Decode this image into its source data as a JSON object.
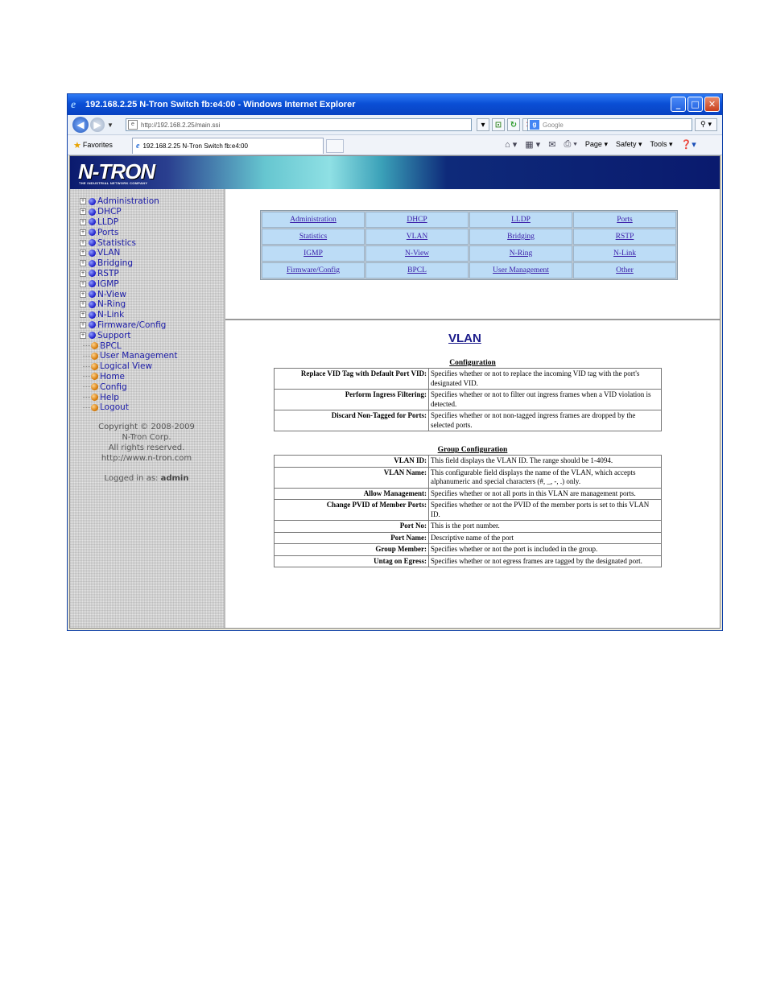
{
  "window": {
    "title": "192.168.2.25 N-Tron Switch fb:e4:00 - Windows Internet Explorer",
    "controls": {
      "minimize": "_",
      "maximize": "□",
      "close": "✕"
    }
  },
  "address_bar": {
    "url": "http://192.168.2.25/main.ssi",
    "search_placeholder": "Google"
  },
  "favorites_bar": {
    "favorites_label": "Favorites",
    "tab_title": "192.168.2.25 N-Tron Switch fb:e4:00",
    "commands": {
      "page": "Page ▾",
      "safety": "Safety ▾",
      "tools": "Tools ▾"
    }
  },
  "banner": {
    "logo": "N-TRON",
    "tagline": "THE INDUSTRIAL NETWORK COMPANY"
  },
  "sidebar": {
    "expandable": [
      "Administration",
      "DHCP",
      "LLDP",
      "Ports",
      "Statistics",
      "VLAN",
      "Bridging",
      "RSTP",
      "IGMP",
      "N-View",
      "N-Ring",
      "N-Link",
      "Firmware/Config",
      "Support"
    ],
    "leaves": [
      "BPCL",
      "User Management",
      "Logical View",
      "Home",
      "Config",
      "Help",
      "Logout"
    ],
    "copyright": [
      "Copyright © 2008-2009",
      "N-Tron Corp.",
      "All rights reserved.",
      "http://www.n-tron.com"
    ],
    "logged_in_label": "Logged in as:",
    "logged_in_user": "admin"
  },
  "menu_grid": [
    [
      "Administration",
      "DHCP",
      "LLDP",
      "Ports"
    ],
    [
      "Statistics",
      "VLAN",
      "Bridging",
      "RSTP"
    ],
    [
      "IGMP",
      "N-View",
      "N-Ring",
      "N-Link"
    ],
    [
      "Firmware/Config",
      "BPCL",
      "User Management",
      "Other"
    ]
  ],
  "help": {
    "title": "VLAN",
    "configuration": {
      "heading": "Configuration",
      "rows": [
        {
          "key": "Replace VID Tag with Default Port VID:",
          "value": "Specifies whether or not to replace the incoming VID tag with the port's designated VID."
        },
        {
          "key": "Perform Ingress Filtering:",
          "value": "Specifies whether or not to filter out ingress frames when a VID violation is detected."
        },
        {
          "key": "Discard Non-Tagged for Ports:",
          "value": "Specifies whether or not non-tagged ingress frames are dropped by the selected ports."
        }
      ]
    },
    "group_configuration": {
      "heading": "Group Configuration",
      "rows": [
        {
          "key": "VLAN ID:",
          "value": "This field displays the VLAN ID. The range should be 1-4094."
        },
        {
          "key": "VLAN Name:",
          "value": "This configurable field displays the name of the VLAN, which accepts alphanumeric and special characters (#, _, -, .) only."
        },
        {
          "key": "Allow Management:",
          "value": "Specifies whether or not all ports in this VLAN are management ports."
        },
        {
          "key": "Change PVID of Member Ports:",
          "value": "Specifies whether or not the PVID of the member ports is set to this VLAN ID."
        },
        {
          "key": "Port No:",
          "value": "This is the port number."
        },
        {
          "key": "Port Name:",
          "value": "Descriptive name of the port"
        },
        {
          "key": "Group Member:",
          "value": "Specifies whether or not the port is included in the group."
        },
        {
          "key": "Untag on Egress:",
          "value": "Specifies whether or not egress frames are tagged by the designated port."
        }
      ]
    }
  }
}
